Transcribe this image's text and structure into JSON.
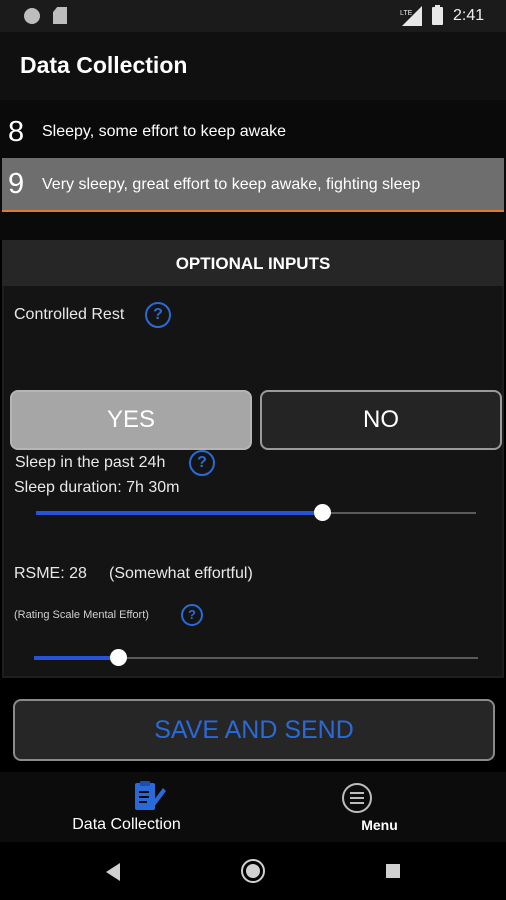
{
  "status_bar": {
    "time": "2:41",
    "network": "LTE"
  },
  "app_bar": {
    "title": "Data Collection"
  },
  "scale": {
    "items": [
      {
        "number": "8",
        "description": "Sleepy, some effort to keep awake",
        "selected": false
      },
      {
        "number": "9",
        "description": "Very sleepy, great effort to keep awake, fighting sleep",
        "selected": true
      }
    ]
  },
  "optional": {
    "header": "OPTIONAL INPUTS",
    "controlled_rest": {
      "label": "Controlled Rest",
      "yes_label": "YES",
      "no_label": "NO",
      "selected": "YES"
    },
    "sleep": {
      "label": "Sleep in the past 24h",
      "duration_text": "Sleep duration: 7h 30m",
      "slider_fraction": 0.65
    },
    "rsme": {
      "value_text": "RSME: 28",
      "meaning": "(Somewhat effortful)",
      "subtitle": "(Rating Scale Mental Effort)",
      "slider_fraction": 0.19
    },
    "help_symbol": "?"
  },
  "save_button": {
    "label": "SAVE AND SEND"
  },
  "bottom_nav": {
    "items": [
      {
        "label": "Data Collection",
        "icon": "clipboard-edit-icon",
        "active": true
      },
      {
        "label": "Menu",
        "icon": "menu-circle-icon",
        "active": false
      }
    ]
  },
  "colors": {
    "accent": "#2A6AD8",
    "slider_fill": "#2953D6",
    "selected_divider": "#E07A2C"
  }
}
